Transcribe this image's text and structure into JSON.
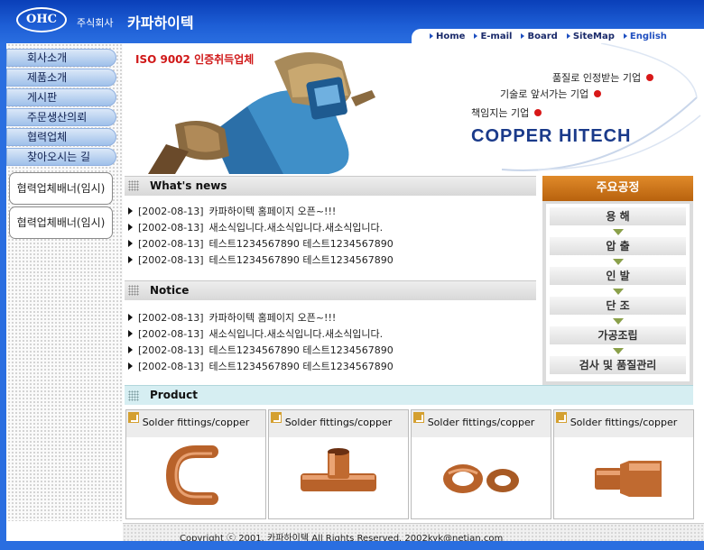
{
  "header": {
    "logo": "OHC",
    "company_prefix": "주식회사",
    "company_name": "카파하이텍",
    "nav": [
      "Home",
      "E-mail",
      "Board",
      "SiteMap"
    ],
    "nav_lang": "English"
  },
  "sidebar": {
    "menu": [
      "회사소개",
      "제품소개",
      "게시판",
      "주문생산의뢰",
      "협력업체",
      "찾아오시는 길"
    ],
    "banners": [
      "협력업체배너(임시)",
      "협력업체배너(임시)"
    ]
  },
  "hero": {
    "iso": "ISO 9002 인증취득업체",
    "slogans": [
      "품질로 인정받는 기업",
      "기술로 앞서가는 기업",
      "책임지는 기업"
    ],
    "brand": "COPPER  HITECH"
  },
  "news": {
    "title": "What's news",
    "items": [
      {
        "date": "[2002-08-13]",
        "text": "카파하이텍 홈페이지 오픈~!!!"
      },
      {
        "date": "[2002-08-13]",
        "text": "새소식입니다.새소식입니다.새소식입니다."
      },
      {
        "date": "[2002-08-13]",
        "text": "테스트1234567890 테스트1234567890"
      },
      {
        "date": "[2002-08-13]",
        "text": "테스트1234567890 테스트1234567890"
      }
    ]
  },
  "notice": {
    "title": "Notice",
    "items": [
      {
        "date": "[2002-08-13]",
        "text": "카파하이텍 홈페이지 오픈~!!!"
      },
      {
        "date": "[2002-08-13]",
        "text": "새소식입니다.새소식입니다.새소식입니다."
      },
      {
        "date": "[2002-08-13]",
        "text": "테스트1234567890 테스트1234567890"
      },
      {
        "date": "[2002-08-13]",
        "text": "테스트1234567890 테스트1234567890"
      }
    ]
  },
  "process": {
    "title": "주요공정",
    "steps": [
      "용 해",
      "압 출",
      "인 발",
      "단 조",
      "가공조립",
      "검사 및 품질관리"
    ]
  },
  "products": {
    "title": "Product",
    "items": [
      "Solder fittings/copper",
      "Solder fittings/copper",
      "Solder fittings/copper",
      "Solder fittings/copper"
    ]
  },
  "footer": {
    "text": "Copyright ⓒ 2001. 카파하이텍 All Rights Reserved. 2002kyk@netian.com"
  },
  "colors": {
    "header_blue": "#1e5fd6",
    "accent_red": "#d81818",
    "process_orange": "#d07a1e",
    "brand_navy": "#1a3a8a"
  }
}
